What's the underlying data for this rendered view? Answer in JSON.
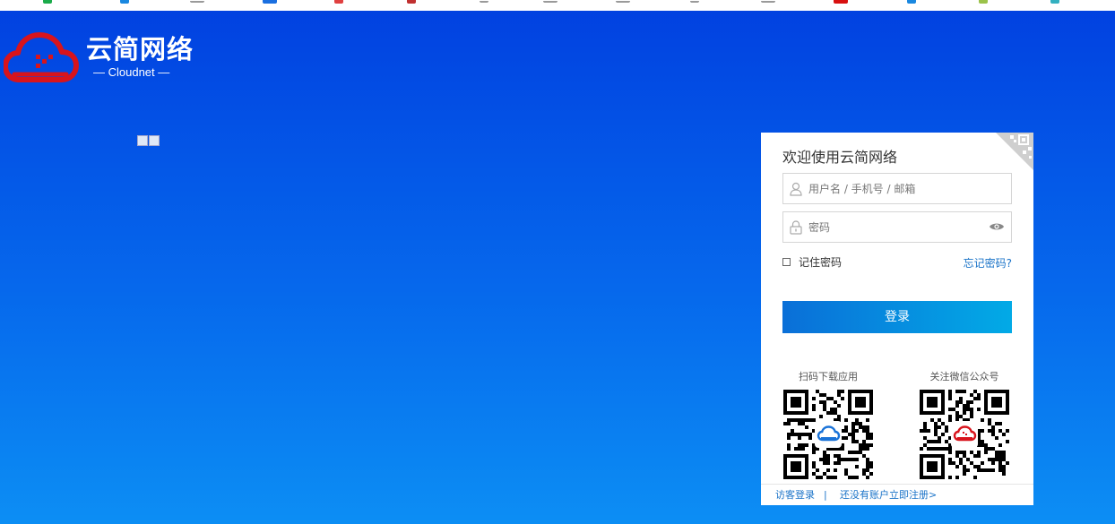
{
  "logo": {
    "name_cn": "云简网络",
    "name_en": "— Cloudnet —"
  },
  "login": {
    "title": "欢迎使用云简网络",
    "username_placeholder": "用户名 / 手机号 / 邮箱",
    "password_placeholder": "密码",
    "remember_label": "记住密码",
    "forgot_label": "忘记密码?",
    "submit_label": "登录"
  },
  "qr_codes": [
    {
      "label": "扫码下载应用",
      "center_icon": "cloud-blue-icon"
    },
    {
      "label": "关注微信公众号",
      "center_icon": "cloud-red-icon"
    }
  ],
  "footer": {
    "guest_label": "访客登录",
    "separator": "|",
    "register_label": "还没有账户立即注册>"
  },
  "colors": {
    "background_top": "#0140e0",
    "background_bottom": "#0c8ef4",
    "brand_red": "#d8141c",
    "button_start": "#0a6fd8",
    "button_end": "#02aae6",
    "link": "#1a73c8"
  }
}
